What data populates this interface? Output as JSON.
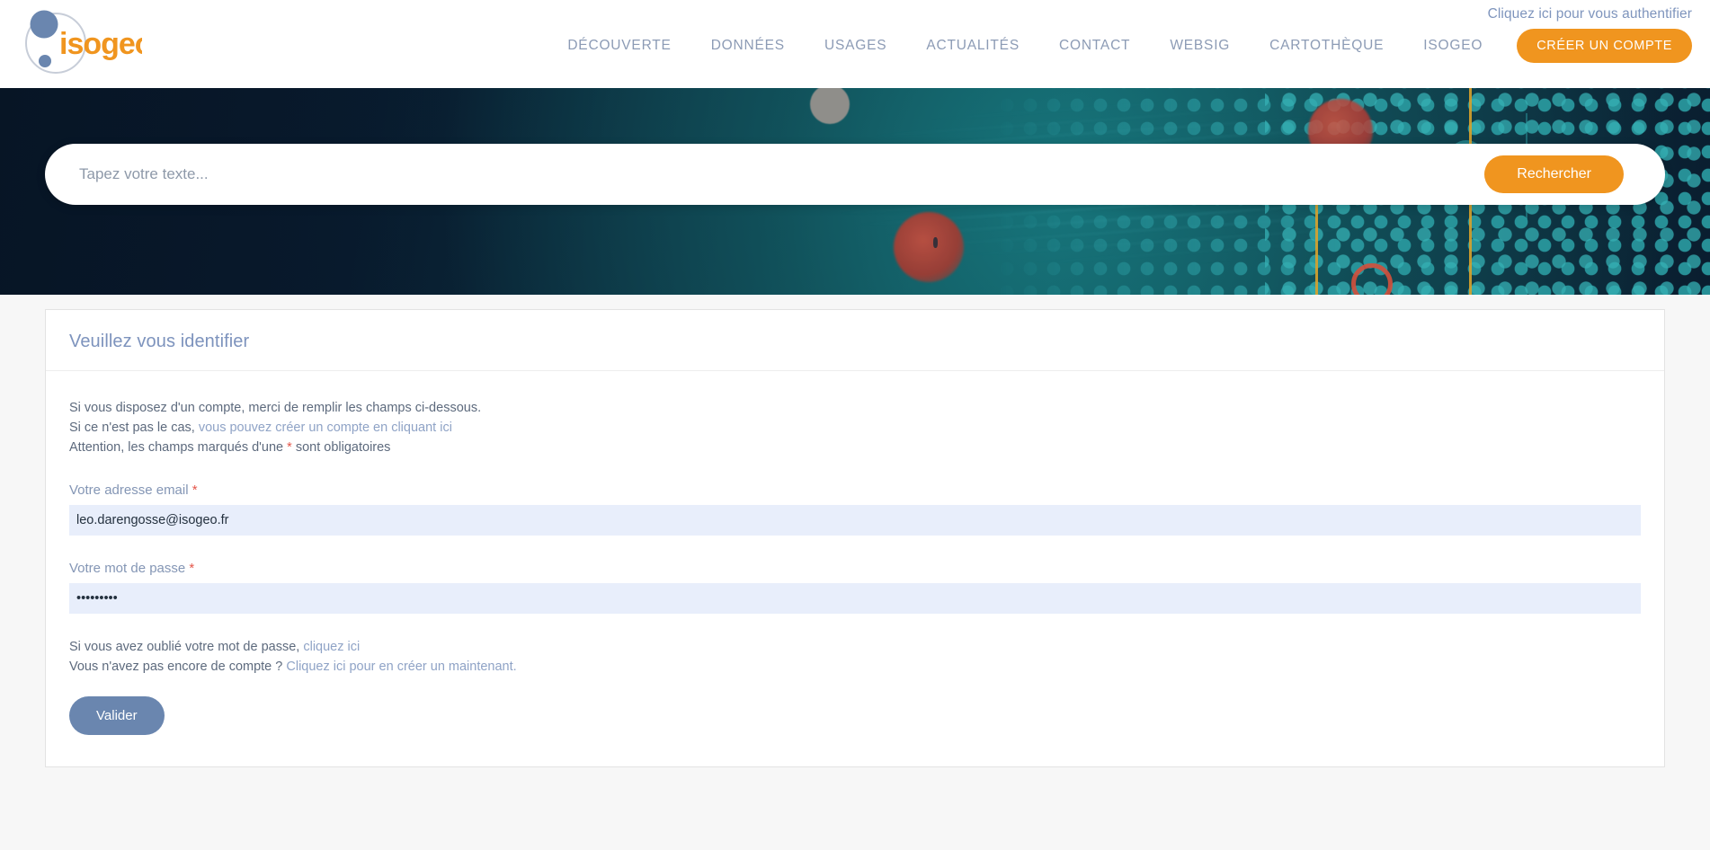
{
  "header": {
    "logo_text": "isogeo",
    "auth_link": "Cliquez ici pour vous authentifier",
    "nav_items": [
      {
        "label": "DÉCOUVERTE"
      },
      {
        "label": "DONNÉES"
      },
      {
        "label": "USAGES"
      },
      {
        "label": "ACTUALITÉS"
      },
      {
        "label": "CONTACT"
      },
      {
        "label": "WEBSIG"
      },
      {
        "label": "CARTOTHÈQUE"
      },
      {
        "label": "ISOGEO"
      }
    ],
    "cta_label": "CRÉER UN COMPTE",
    "accent_color": "#f0951f",
    "nav_text_color": "#8c9bb5"
  },
  "hero": {
    "search_placeholder": "Tapez votre texte...",
    "search_value": "",
    "search_button_label": "Rechercher",
    "advanced_toggle": "+",
    "background_color": "#08192b",
    "accent_teal": "#2a9aa0"
  },
  "login_card": {
    "title": "Veuillez vous identifier",
    "intro": {
      "line1": "Si vous disposez d'un compte, merci de remplir les champs ci-dessous.",
      "line2_prefix": "Si ce n'est pas le cas, ",
      "line2_link": "vous pouvez créer un compte en cliquant ici",
      "line3_prefix": "Attention, les champs marqués d'une ",
      "line3_star": "*",
      "line3_suffix": " sont obligatoires"
    },
    "email": {
      "label": "Votre adresse email",
      "required_marker": "*",
      "value": "leo.darengosse@isogeo.fr",
      "placeholder": ""
    },
    "password": {
      "label": "Votre mot de passe",
      "required_marker": "*",
      "value": "•••••••••",
      "placeholder": ""
    },
    "helper": {
      "forgot_prefix": "Si vous avez oublié votre mot de passe, ",
      "forgot_link": "cliquez ici",
      "signup_prefix": "Vous n'avez pas encore de compte ? ",
      "signup_link": "Cliquez ici pour en créer un maintenant."
    },
    "submit_label": "Valider",
    "submit_color": "#6a86af",
    "title_color": "#7d93bd",
    "input_bg": "#e8eefb",
    "required_color": "#e4564a"
  }
}
